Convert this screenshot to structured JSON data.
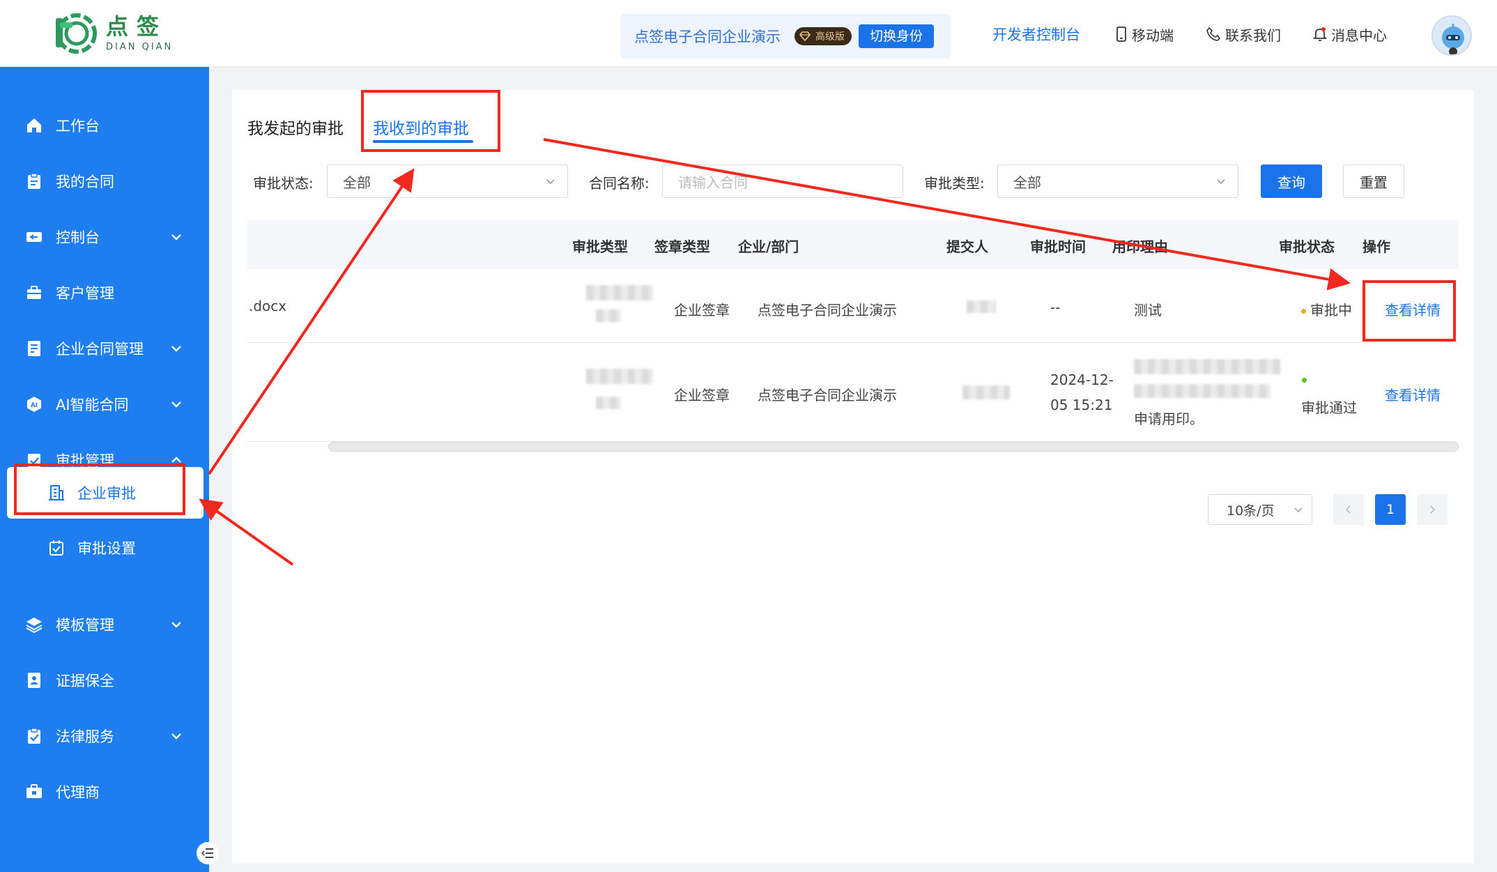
{
  "brand": {
    "name_cn": "点签",
    "name_en": "DIAN QIAN"
  },
  "header": {
    "company": "点签电子合同企业演示",
    "badge": "高级版",
    "switch_label": "切换身份",
    "links": {
      "developer": "开发者控制台",
      "mobile": "移动端",
      "contact": "联系我们",
      "messages": "消息中心"
    }
  },
  "sidebar": {
    "items": [
      {
        "label": "工作台",
        "icon": "home-icon"
      },
      {
        "label": "我的合同",
        "icon": "clipboard-icon"
      },
      {
        "label": "控制台",
        "icon": "console-icon"
      },
      {
        "label": "客户管理",
        "icon": "briefcase-icon"
      },
      {
        "label": "企业合同管理",
        "icon": "document-icon"
      },
      {
        "label": "AI智能合同",
        "icon": "ai-icon"
      },
      {
        "label": "审批管理",
        "icon": "approval-icon"
      },
      {
        "label": "模板管理",
        "icon": "layers-icon"
      },
      {
        "label": "证据保全",
        "icon": "evidence-icon"
      },
      {
        "label": "法律服务",
        "icon": "legal-icon"
      },
      {
        "label": "代理商",
        "icon": "agent-icon"
      }
    ],
    "sub_items": [
      {
        "label": "企业审批",
        "icon": "building-icon"
      },
      {
        "label": "审批设置",
        "icon": "checkbox-icon"
      }
    ]
  },
  "tabs": {
    "sent": "我发起的审批",
    "received": "我收到的审批"
  },
  "filters": {
    "status_label": "审批状态:",
    "status_value": "全部",
    "name_label": "合同名称:",
    "name_placeholder": "请输入合同",
    "type_label": "审批类型:",
    "type_value": "全部",
    "query": "查询",
    "reset": "重置"
  },
  "table": {
    "columns": [
      "审批类型",
      "签章类型",
      "企业/部门",
      "提交人",
      "审批时间",
      "用印理由",
      "审批状态",
      "操作"
    ],
    "rows": [
      {
        "file": ".docx",
        "seal_type": "企业签章",
        "company": "点签电子合同企业演示",
        "time": "--",
        "time_line2": "",
        "reason": "测试",
        "status": "审批中",
        "status_color": "#f5a623",
        "action": "查看详情"
      },
      {
        "file": "",
        "seal_type": "企业签章",
        "company": "点签电子合同企业演示",
        "time": "2024-12-",
        "time_line2": "05 15:21",
        "reason": "申请用印。",
        "status": "审批通过",
        "status_color": "#52c41a",
        "action": "查看详情"
      }
    ]
  },
  "pagination": {
    "page_size": "10条/页",
    "current": "1"
  },
  "colors": {
    "primary": "#1a73e8",
    "sidebar": "#1e7ef0",
    "annotation": "#f0281e"
  }
}
